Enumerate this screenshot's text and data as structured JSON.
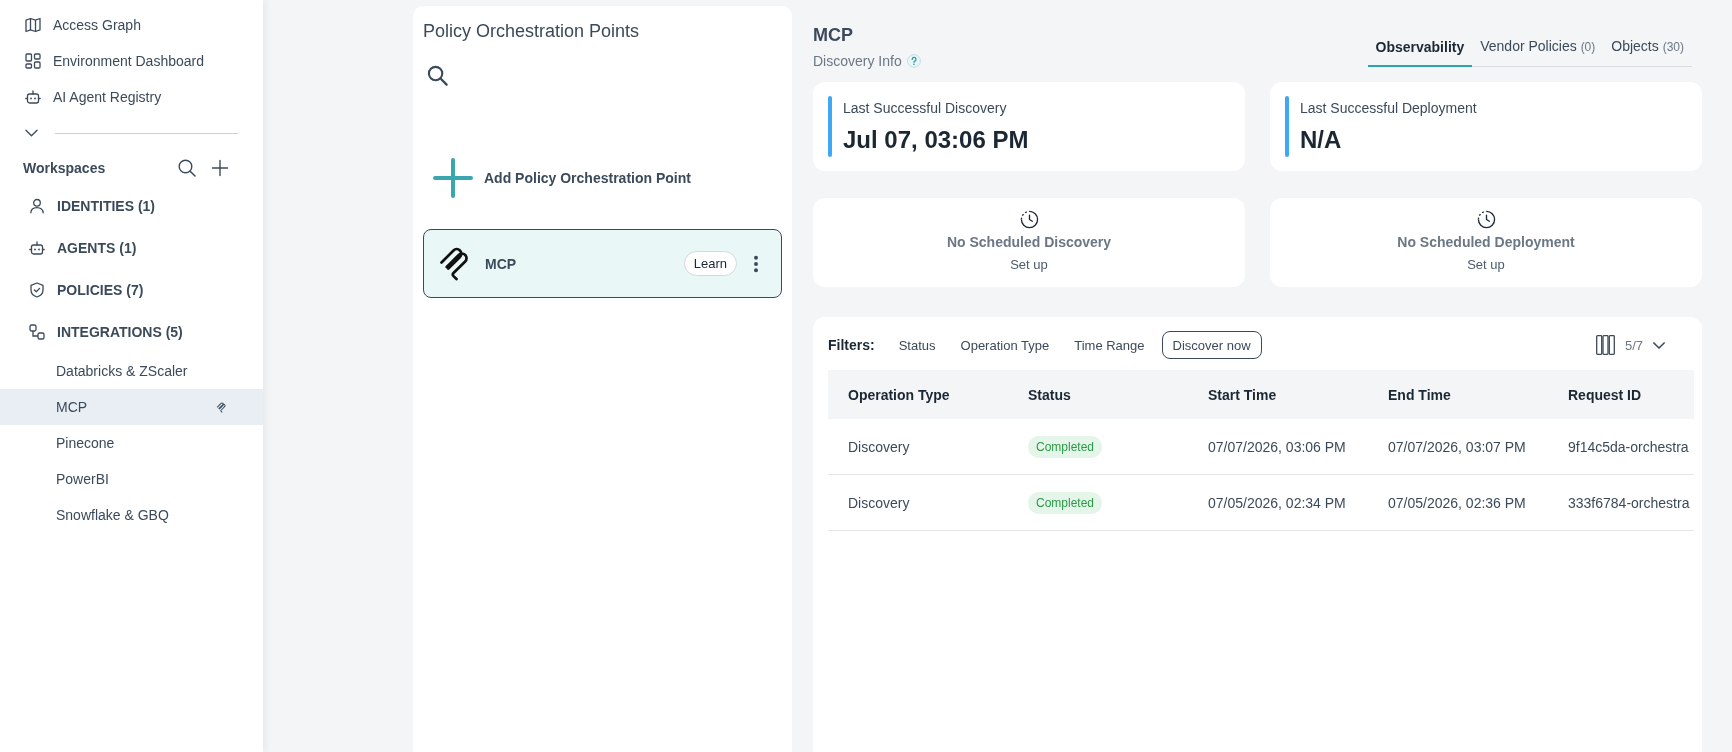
{
  "sidebar": {
    "nav": [
      {
        "label": "Access Graph"
      },
      {
        "label": "Environment Dashboard"
      },
      {
        "label": "AI Agent Registry"
      }
    ],
    "workspaces_label": "Workspaces",
    "workspaces": [
      {
        "label": "IDENTITIES (1)"
      },
      {
        "label": "AGENTS (1)"
      },
      {
        "label": "POLICIES (7)"
      },
      {
        "label": "INTEGRATIONS (5)",
        "children": [
          {
            "label": "Databricks & ZScaler",
            "selected": false
          },
          {
            "label": "MCP",
            "selected": true
          },
          {
            "label": "Pinecone",
            "selected": false
          },
          {
            "label": "PowerBI",
            "selected": false
          },
          {
            "label": "Snowflake & GBQ",
            "selected": false
          }
        ]
      }
    ]
  },
  "points_panel": {
    "title": "Policy Orchestration Points",
    "add_label": "Add Policy Orchestration Point",
    "items": [
      {
        "name": "MCP",
        "action": "Learn",
        "selected": true
      }
    ]
  },
  "detail": {
    "title": "MCP",
    "subtitle": "Discovery Info",
    "tabs": [
      {
        "label": "Observability",
        "selected": true
      },
      {
        "label": "Vendor Policies",
        "count": "(0)",
        "selected": false
      },
      {
        "label": "Objects",
        "count": "(30)",
        "selected": false
      }
    ],
    "stats": [
      {
        "label": "Last Successful Discovery",
        "value": "Jul 07, 03:06 PM"
      },
      {
        "label": "Last Successful Deployment",
        "value": "N/A"
      }
    ],
    "schedules": [
      {
        "title": "No Scheduled Discovery",
        "action": "Set up"
      },
      {
        "title": "No Scheduled Deployment",
        "action": "Set up"
      }
    ],
    "filters": {
      "label": "Filters:",
      "options": [
        "Status",
        "Operation Type",
        "Time Range"
      ],
      "action": "Discover now",
      "columns_shown": "5/7"
    },
    "table": {
      "columns": [
        "Operation Type",
        "Status",
        "Start Time",
        "End Time",
        "Request ID"
      ],
      "rows": [
        {
          "operation_type": "Discovery",
          "status": "Completed",
          "start_time": "07/07/2026, 03:06 PM",
          "end_time": "07/07/2026, 03:07 PM",
          "request_id": "9f14c5da-orchestra"
        },
        {
          "operation_type": "Discovery",
          "status": "Completed",
          "start_time": "07/05/2026, 02:34 PM",
          "end_time": "07/05/2026, 02:36 PM",
          "request_id": "333f6784-orchestra"
        }
      ]
    }
  }
}
